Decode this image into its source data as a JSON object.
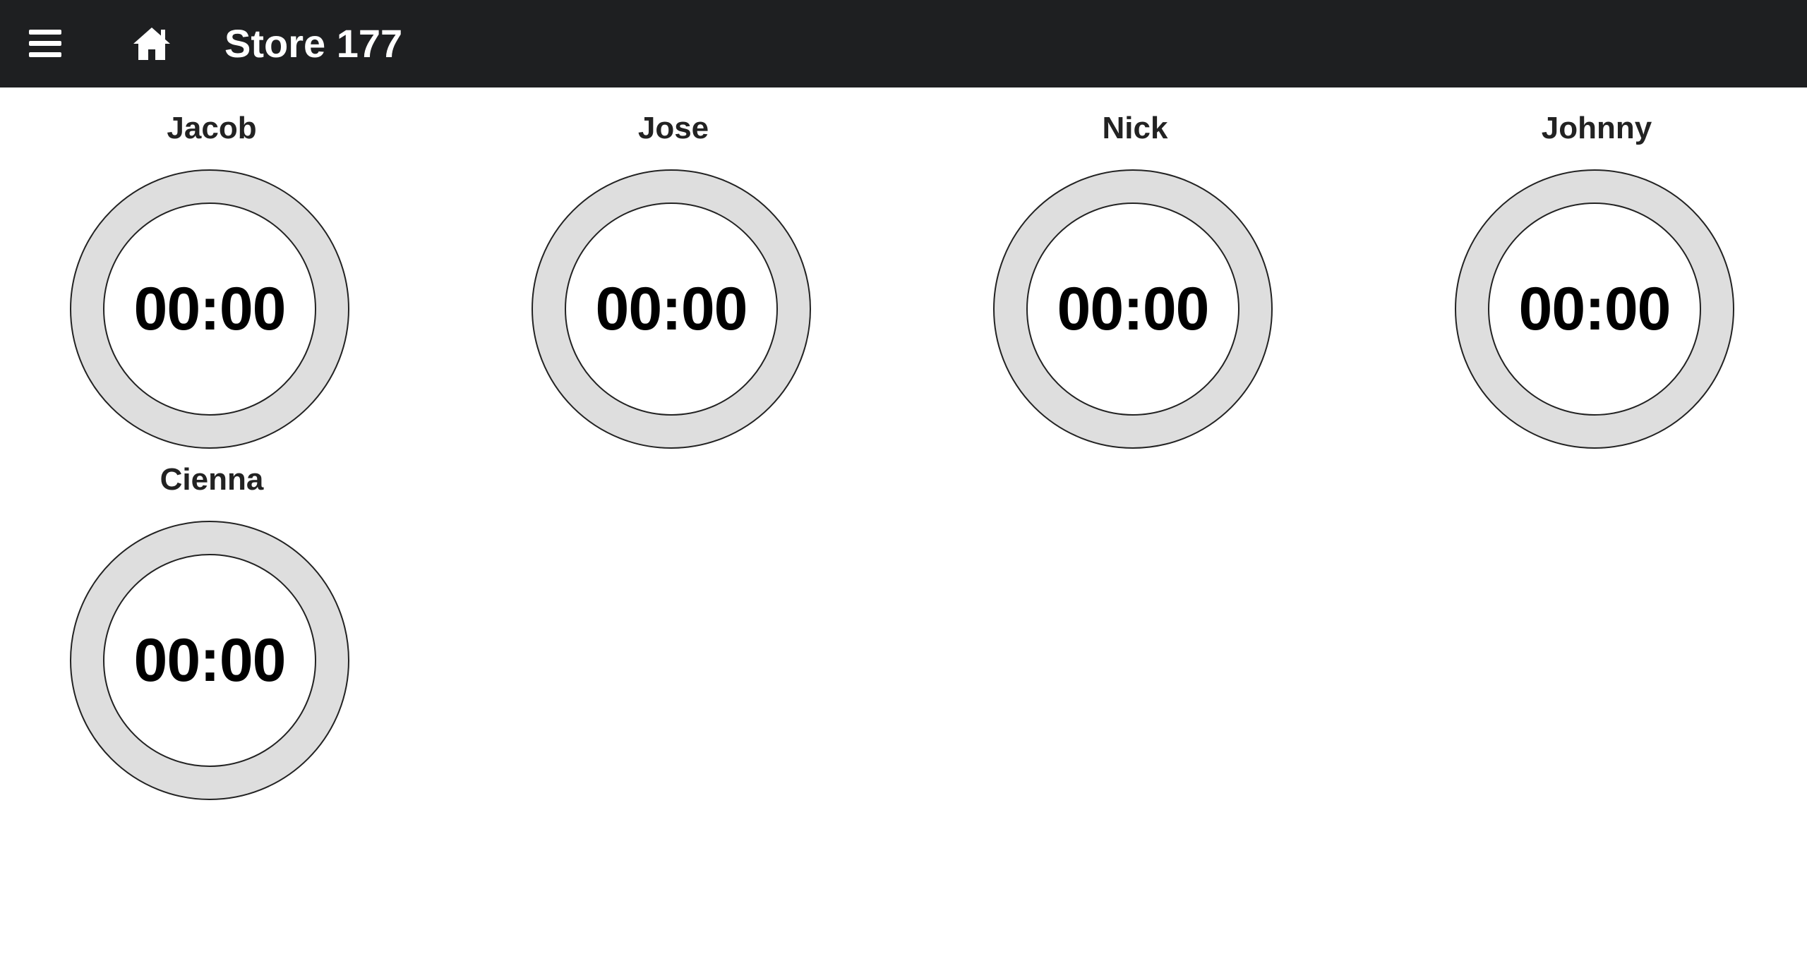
{
  "header": {
    "title": "Store 177",
    "menu_icon": "hamburger-menu-icon",
    "home_icon": "home-icon",
    "background_color": "#1e1f21"
  },
  "timers": [
    {
      "name": "Jacob",
      "time": "00:00"
    },
    {
      "name": "Jose",
      "time": "00:00"
    },
    {
      "name": "Nick",
      "time": "00:00"
    },
    {
      "name": "Johnny",
      "time": "00:00"
    },
    {
      "name": "Cienna",
      "time": "00:00"
    }
  ],
  "colors": {
    "ring": "#dedede",
    "outline": "#222222"
  }
}
